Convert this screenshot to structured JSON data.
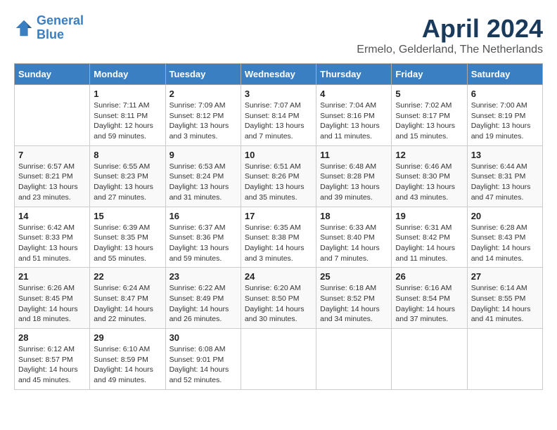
{
  "logo": {
    "line1": "General",
    "line2": "Blue"
  },
  "title": "April 2024",
  "subtitle": "Ermelo, Gelderland, The Netherlands",
  "days_of_week": [
    "Sunday",
    "Monday",
    "Tuesday",
    "Wednesday",
    "Thursday",
    "Friday",
    "Saturday"
  ],
  "weeks": [
    [
      {
        "day": "",
        "info": ""
      },
      {
        "day": "1",
        "info": "Sunrise: 7:11 AM\nSunset: 8:11 PM\nDaylight: 12 hours\nand 59 minutes."
      },
      {
        "day": "2",
        "info": "Sunrise: 7:09 AM\nSunset: 8:12 PM\nDaylight: 13 hours\nand 3 minutes."
      },
      {
        "day": "3",
        "info": "Sunrise: 7:07 AM\nSunset: 8:14 PM\nDaylight: 13 hours\nand 7 minutes."
      },
      {
        "day": "4",
        "info": "Sunrise: 7:04 AM\nSunset: 8:16 PM\nDaylight: 13 hours\nand 11 minutes."
      },
      {
        "day": "5",
        "info": "Sunrise: 7:02 AM\nSunset: 8:17 PM\nDaylight: 13 hours\nand 15 minutes."
      },
      {
        "day": "6",
        "info": "Sunrise: 7:00 AM\nSunset: 8:19 PM\nDaylight: 13 hours\nand 19 minutes."
      }
    ],
    [
      {
        "day": "7",
        "info": "Sunrise: 6:57 AM\nSunset: 8:21 PM\nDaylight: 13 hours\nand 23 minutes."
      },
      {
        "day": "8",
        "info": "Sunrise: 6:55 AM\nSunset: 8:23 PM\nDaylight: 13 hours\nand 27 minutes."
      },
      {
        "day": "9",
        "info": "Sunrise: 6:53 AM\nSunset: 8:24 PM\nDaylight: 13 hours\nand 31 minutes."
      },
      {
        "day": "10",
        "info": "Sunrise: 6:51 AM\nSunset: 8:26 PM\nDaylight: 13 hours\nand 35 minutes."
      },
      {
        "day": "11",
        "info": "Sunrise: 6:48 AM\nSunset: 8:28 PM\nDaylight: 13 hours\nand 39 minutes."
      },
      {
        "day": "12",
        "info": "Sunrise: 6:46 AM\nSunset: 8:30 PM\nDaylight: 13 hours\nand 43 minutes."
      },
      {
        "day": "13",
        "info": "Sunrise: 6:44 AM\nSunset: 8:31 PM\nDaylight: 13 hours\nand 47 minutes."
      }
    ],
    [
      {
        "day": "14",
        "info": "Sunrise: 6:42 AM\nSunset: 8:33 PM\nDaylight: 13 hours\nand 51 minutes."
      },
      {
        "day": "15",
        "info": "Sunrise: 6:39 AM\nSunset: 8:35 PM\nDaylight: 13 hours\nand 55 minutes."
      },
      {
        "day": "16",
        "info": "Sunrise: 6:37 AM\nSunset: 8:36 PM\nDaylight: 13 hours\nand 59 minutes."
      },
      {
        "day": "17",
        "info": "Sunrise: 6:35 AM\nSunset: 8:38 PM\nDaylight: 14 hours\nand 3 minutes."
      },
      {
        "day": "18",
        "info": "Sunrise: 6:33 AM\nSunset: 8:40 PM\nDaylight: 14 hours\nand 7 minutes."
      },
      {
        "day": "19",
        "info": "Sunrise: 6:31 AM\nSunset: 8:42 PM\nDaylight: 14 hours\nand 11 minutes."
      },
      {
        "day": "20",
        "info": "Sunrise: 6:28 AM\nSunset: 8:43 PM\nDaylight: 14 hours\nand 14 minutes."
      }
    ],
    [
      {
        "day": "21",
        "info": "Sunrise: 6:26 AM\nSunset: 8:45 PM\nDaylight: 14 hours\nand 18 minutes."
      },
      {
        "day": "22",
        "info": "Sunrise: 6:24 AM\nSunset: 8:47 PM\nDaylight: 14 hours\nand 22 minutes."
      },
      {
        "day": "23",
        "info": "Sunrise: 6:22 AM\nSunset: 8:49 PM\nDaylight: 14 hours\nand 26 minutes."
      },
      {
        "day": "24",
        "info": "Sunrise: 6:20 AM\nSunset: 8:50 PM\nDaylight: 14 hours\nand 30 minutes."
      },
      {
        "day": "25",
        "info": "Sunrise: 6:18 AM\nSunset: 8:52 PM\nDaylight: 14 hours\nand 34 minutes."
      },
      {
        "day": "26",
        "info": "Sunrise: 6:16 AM\nSunset: 8:54 PM\nDaylight: 14 hours\nand 37 minutes."
      },
      {
        "day": "27",
        "info": "Sunrise: 6:14 AM\nSunset: 8:55 PM\nDaylight: 14 hours\nand 41 minutes."
      }
    ],
    [
      {
        "day": "28",
        "info": "Sunrise: 6:12 AM\nSunset: 8:57 PM\nDaylight: 14 hours\nand 45 minutes."
      },
      {
        "day": "29",
        "info": "Sunrise: 6:10 AM\nSunset: 8:59 PM\nDaylight: 14 hours\nand 49 minutes."
      },
      {
        "day": "30",
        "info": "Sunrise: 6:08 AM\nSunset: 9:01 PM\nDaylight: 14 hours\nand 52 minutes."
      },
      {
        "day": "",
        "info": ""
      },
      {
        "day": "",
        "info": ""
      },
      {
        "day": "",
        "info": ""
      },
      {
        "day": "",
        "info": ""
      }
    ]
  ]
}
